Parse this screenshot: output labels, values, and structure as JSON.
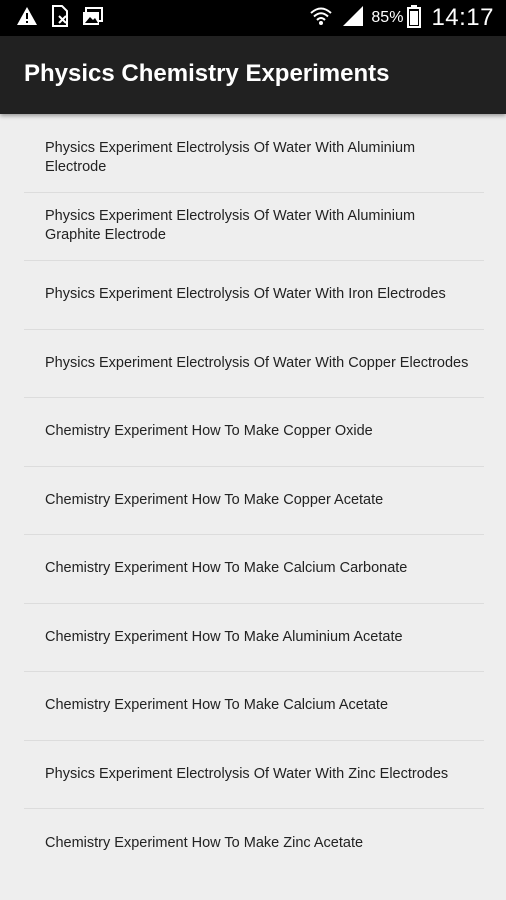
{
  "status_bar": {
    "icons_left": [
      "warning-icon",
      "no-sim-icon",
      "photo-notification-icon"
    ],
    "icons_right": [
      "wifi-icon",
      "signal-icon"
    ],
    "battery_percent": "85%",
    "time": "14:17"
  },
  "app_bar": {
    "title": "Physics Chemistry Experiments",
    "background": "#212121"
  },
  "list": {
    "items": [
      {
        "label": "Physics Experiment Electrolysis Of Water With Aluminium Electrode"
      },
      {
        "label": "Physics Experiment Electrolysis Of Water With Aluminium Graphite Electrode"
      },
      {
        "label": "Physics Experiment Electrolysis Of Water With Iron Electrodes"
      },
      {
        "label": "Physics Experiment Electrolysis Of Water With Copper Electrodes"
      },
      {
        "label": "Chemistry Experiment How To Make Copper Oxide"
      },
      {
        "label": "Chemistry Experiment How To Make Copper Acetate"
      },
      {
        "label": "Chemistry Experiment How To Make Calcium Carbonate"
      },
      {
        "label": "Chemistry Experiment How To Make Aluminium Acetate"
      },
      {
        "label": "Chemistry Experiment How To Make Calcium Acetate"
      },
      {
        "label": "Physics Experiment Electrolysis Of Water With Zinc Electrodes"
      },
      {
        "label": "Chemistry Experiment How To Make Zinc Acetate"
      }
    ]
  }
}
